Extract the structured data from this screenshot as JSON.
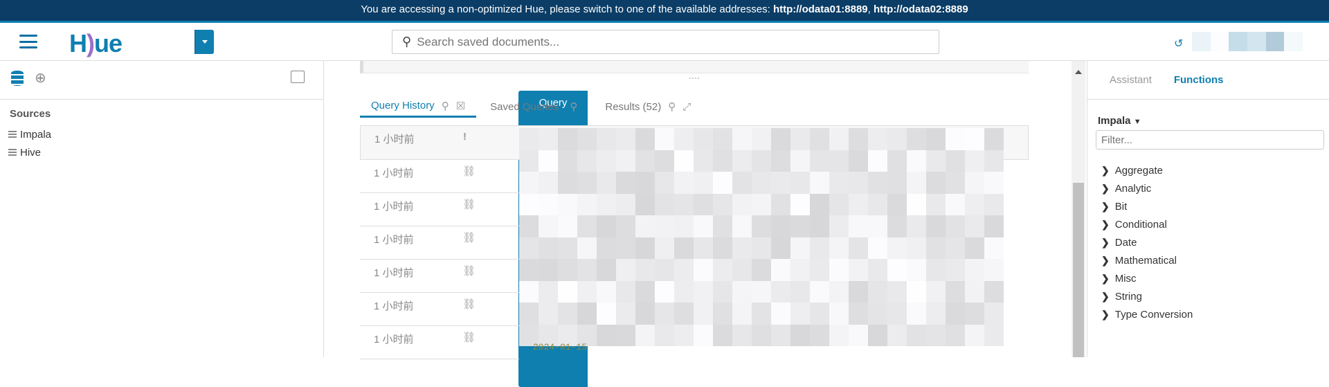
{
  "banner": {
    "text": "You are accessing a non-optimized Hue, please switch to one of the available addresses: ",
    "addr1": "http://odata01:8889",
    "sep": ", ",
    "addr2": "http://odata02:8889"
  },
  "header": {
    "logo": "HUE",
    "query_label": "Query",
    "search_placeholder": "Search saved documents..."
  },
  "sidebar": {
    "sources_title": "Sources",
    "sources": [
      {
        "label": "Impala"
      },
      {
        "label": "Hive"
      }
    ]
  },
  "tabs": [
    {
      "label": "Query History"
    },
    {
      "label": "Saved Queries"
    },
    {
      "label": "Results (52)"
    }
  ],
  "history": [
    {
      "time": "1 小时前",
      "status": "!"
    },
    {
      "time": "1 小时前",
      "status": "unlink"
    },
    {
      "time": "1 小时前",
      "status": "unlink"
    },
    {
      "time": "1 小时前",
      "status": "unlink"
    },
    {
      "time": "1 小时前",
      "status": "unlink"
    },
    {
      "time": "1 小时前",
      "status": "unlink"
    },
    {
      "time": "1 小时前",
      "status": "unlink"
    }
  ],
  "partial_date": "2024-01-15",
  "right": {
    "tabs": [
      {
        "label": "Assistant"
      },
      {
        "label": "Functions"
      }
    ],
    "dialect": "Impala",
    "filter_placeholder": "Filter...",
    "categories": [
      "Aggregate",
      "Analytic",
      "Bit",
      "Conditional",
      "Date",
      "Mathematical",
      "Misc",
      "String",
      "Type Conversion"
    ]
  },
  "colors": {
    "brand": "#0f7fb0",
    "banner": "#0b3d66"
  }
}
